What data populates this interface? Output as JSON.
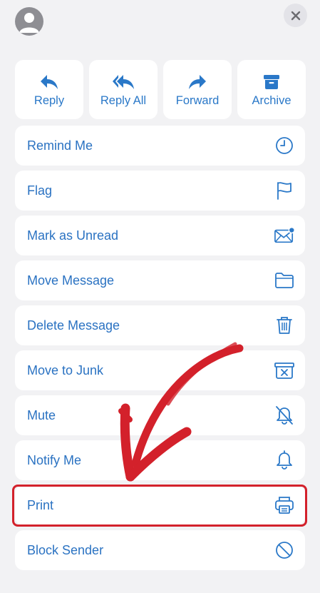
{
  "top_actions": [
    {
      "label": "Reply",
      "icon": "reply-icon"
    },
    {
      "label": "Reply All",
      "icon": "reply-all-icon"
    },
    {
      "label": "Forward",
      "icon": "forward-icon"
    },
    {
      "label": "Archive",
      "icon": "archive-icon"
    }
  ],
  "menu": [
    {
      "label": "Remind Me",
      "icon": "clock-icon"
    },
    {
      "label": "Flag",
      "icon": "flag-icon"
    },
    {
      "label": "Mark as Unread",
      "icon": "envelope-unread-icon"
    },
    {
      "label": "Move Message",
      "icon": "folder-icon"
    },
    {
      "label": "Delete Message",
      "icon": "trash-icon"
    },
    {
      "label": "Move to Junk",
      "icon": "junk-icon"
    },
    {
      "label": "Mute",
      "icon": "bell-slash-icon"
    },
    {
      "label": "Notify Me",
      "icon": "bell-icon"
    },
    {
      "label": "Print",
      "icon": "printer-icon"
    },
    {
      "label": "Block Sender",
      "icon": "block-icon"
    }
  ],
  "colors": {
    "accent": "#2a78c8",
    "background": "#f2f2f4",
    "card": "#ffffff",
    "annotation": "#d3212b"
  }
}
